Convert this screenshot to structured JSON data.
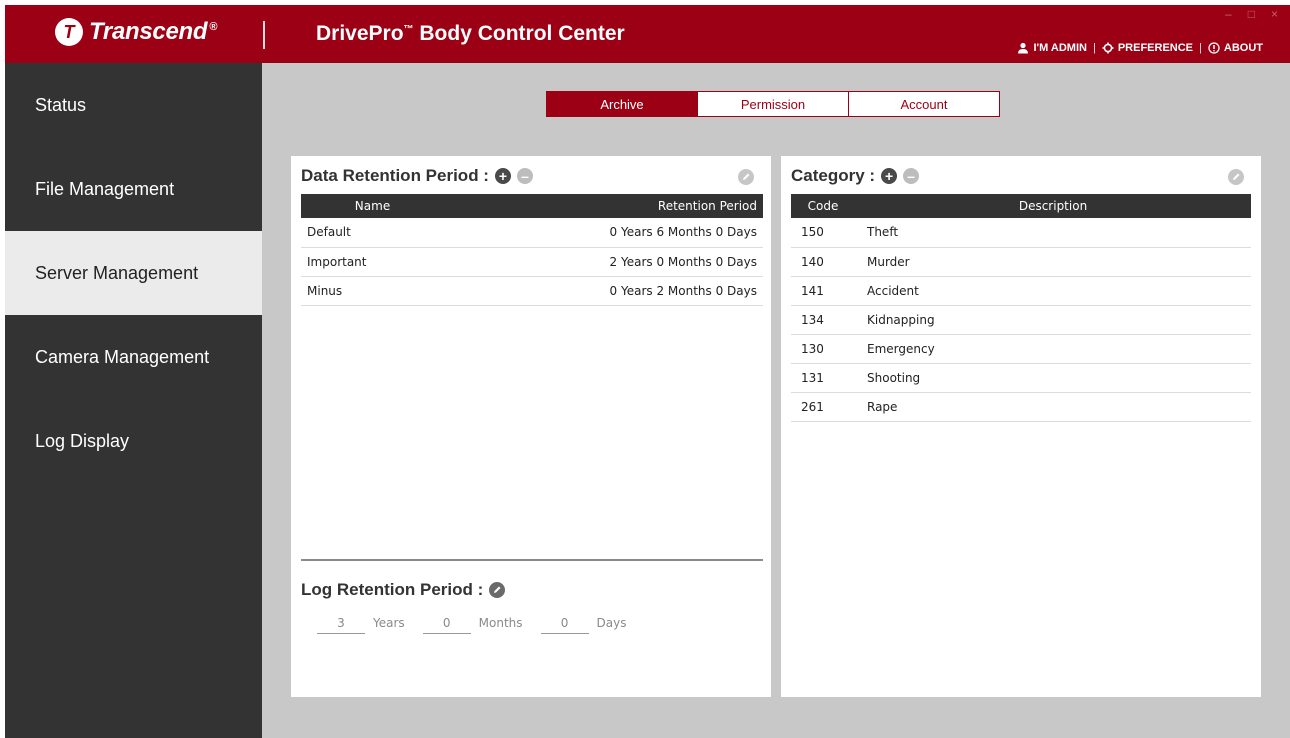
{
  "header": {
    "logo_mark": "T",
    "logo_text": "Transcend",
    "logo_reg": "®",
    "title_main": "DrivePro",
    "title_tm": "™",
    "title_rest": " Body Control Center",
    "window_controls": {
      "minimize": "–",
      "maximize": "□",
      "close": "×"
    },
    "links": {
      "admin": "I'M ADMIN",
      "separator": "|",
      "preference": "PREFERENCE",
      "about": "ABOUT"
    }
  },
  "sidebar": {
    "items": [
      {
        "label": "Status"
      },
      {
        "label": "File Management"
      },
      {
        "label": "Server Management"
      },
      {
        "label": "Camera Management"
      },
      {
        "label": "Log Display"
      }
    ]
  },
  "tabs": [
    {
      "label": "Archive"
    },
    {
      "label": "Permission"
    },
    {
      "label": "Account"
    }
  ],
  "retention": {
    "title": "Data Retention Period :",
    "columns": {
      "name": "Name",
      "period": "Retention Period"
    },
    "rows": [
      {
        "name": "Default",
        "period": "0 Years 6 Months 0 Days"
      },
      {
        "name": "Important",
        "period": "2 Years 0 Months 0 Days"
      },
      {
        "name": "Minus",
        "period": "0 Years 2 Months 0 Days"
      }
    ]
  },
  "log_retention": {
    "title": "Log Retention Period :",
    "years_value": "3",
    "years_label": "Years",
    "months_value": "0",
    "months_label": "Months",
    "days_value": "0",
    "days_label": "Days"
  },
  "category": {
    "title": "Category :",
    "columns": {
      "code": "Code",
      "description": "Description"
    },
    "rows": [
      {
        "code": "150",
        "description": "Theft"
      },
      {
        "code": "140",
        "description": "Murder"
      },
      {
        "code": "141",
        "description": "Accident"
      },
      {
        "code": "134",
        "description": "Kidnapping"
      },
      {
        "code": "130",
        "description": "Emergency"
      },
      {
        "code": "131",
        "description": "Shooting"
      },
      {
        "code": "261",
        "description": "Rape"
      }
    ]
  },
  "icons": {
    "add": "+",
    "remove": "–"
  },
  "colors": {
    "brand_red": "#9b0014",
    "sidebar_bg": "#333333",
    "sidebar_active_bg": "#ebebeb",
    "main_bg": "#c8c8c8"
  }
}
